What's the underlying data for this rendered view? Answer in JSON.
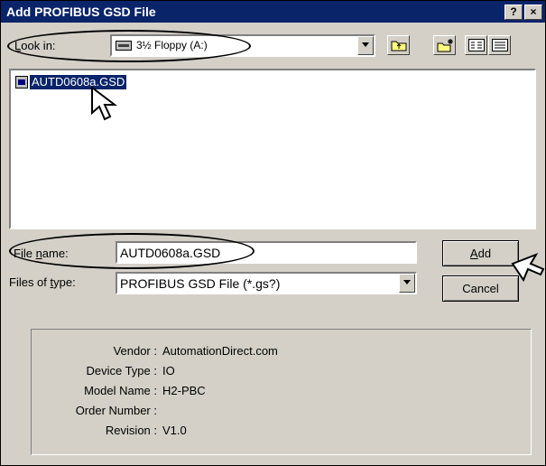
{
  "window": {
    "title": "Add PROFIBUS GSD File",
    "help_label": "?",
    "close_label": "×"
  },
  "look_in": {
    "label_prefix": "",
    "label_underline": "L",
    "label_rest": "ook in:",
    "value": "3½ Floppy (A:)",
    "drive_icon": "floppy-drive-icon"
  },
  "toolbar": {
    "up_icon": "up-folder-icon",
    "new_folder_icon": "new-folder-icon",
    "list_icon": "list-view-icon",
    "details_icon": "details-view-icon"
  },
  "file_list": {
    "items": [
      {
        "name": "AUTD0608a.GSD",
        "icon": "gsd-file-icon",
        "selected": true
      }
    ]
  },
  "file_name": {
    "label_prefix": "File ",
    "label_underline": "n",
    "label_rest": "ame:",
    "value": "AUTD0608a.GSD"
  },
  "file_type": {
    "label_prefix": "Files of ",
    "label_underline": "t",
    "label_rest": "ype:",
    "value": "PROFIBUS GSD File (*.gs?)"
  },
  "buttons": {
    "add_underline": "A",
    "add_rest": "dd",
    "cancel": "Cancel"
  },
  "info": {
    "rows": [
      {
        "key": "Vendor :",
        "value": "AutomationDirect.com"
      },
      {
        "key": "Device Type :",
        "value": "IO"
      },
      {
        "key": "Model Name :",
        "value": "H2-PBC"
      },
      {
        "key": "Order Number :",
        "value": ""
      },
      {
        "key": "Revision :",
        "value": "V1.0"
      }
    ]
  }
}
